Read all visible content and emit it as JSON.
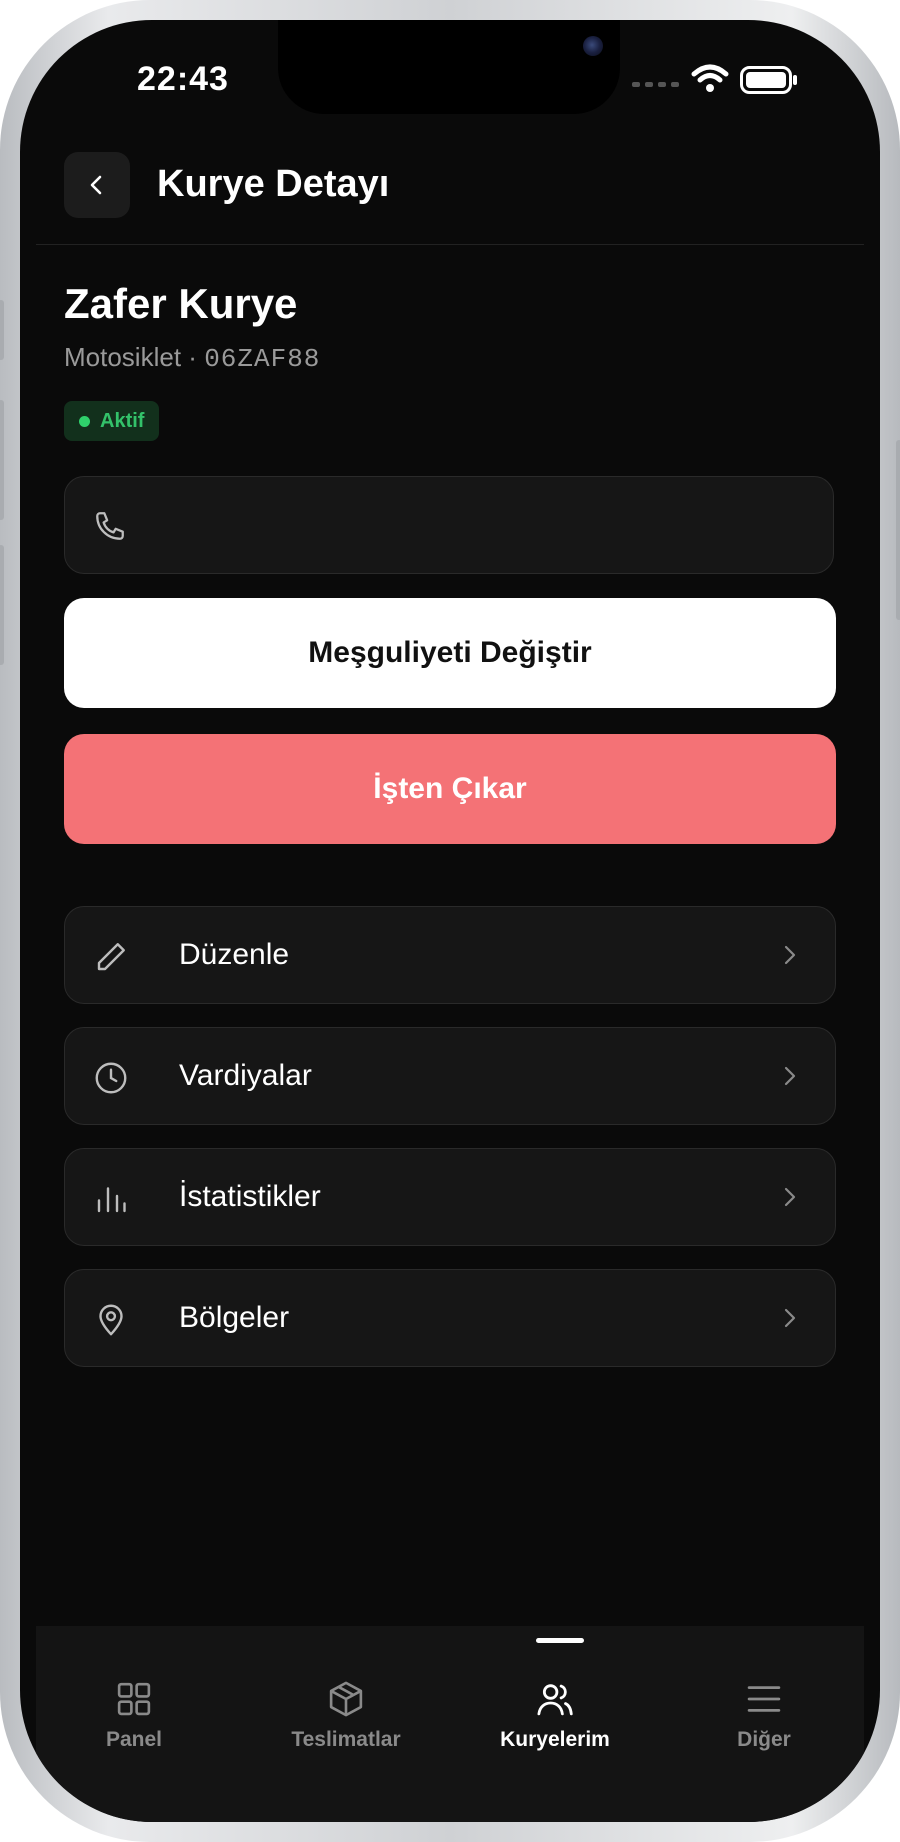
{
  "status_bar": {
    "time": "22:43"
  },
  "header": {
    "title": "Kurye Detayı"
  },
  "courier": {
    "name": "Zafer Kurye",
    "vehicle": "Motosiklet",
    "separator": "·",
    "plate": "06ZAF88",
    "status": "Aktif"
  },
  "phone": {
    "value": ""
  },
  "actions": {
    "toggle_busy_label": "Meşguliyeti Değiştir",
    "fire_label": "İşten Çıkar"
  },
  "menu": [
    {
      "label": "Düzenle",
      "icon": "pencil-icon"
    },
    {
      "label": "Vardiyalar",
      "icon": "clock-icon"
    },
    {
      "label": "İstatistikler",
      "icon": "bar-chart-icon"
    },
    {
      "label": "Bölgeler",
      "icon": "map-pin-icon"
    }
  ],
  "tabbar": {
    "tabs": [
      {
        "label": "Panel",
        "icon": "grid-icon",
        "active": false
      },
      {
        "label": "Teslimatlar",
        "icon": "box-icon",
        "active": false
      },
      {
        "label": "Kuryelerim",
        "icon": "users-icon",
        "active": true
      },
      {
        "label": "Diğer",
        "icon": "menu-icon",
        "active": false
      }
    ]
  },
  "colors": {
    "background": "#0a0a0a",
    "card": "#161616",
    "danger": "#f47276",
    "success": "#2fd06b"
  }
}
